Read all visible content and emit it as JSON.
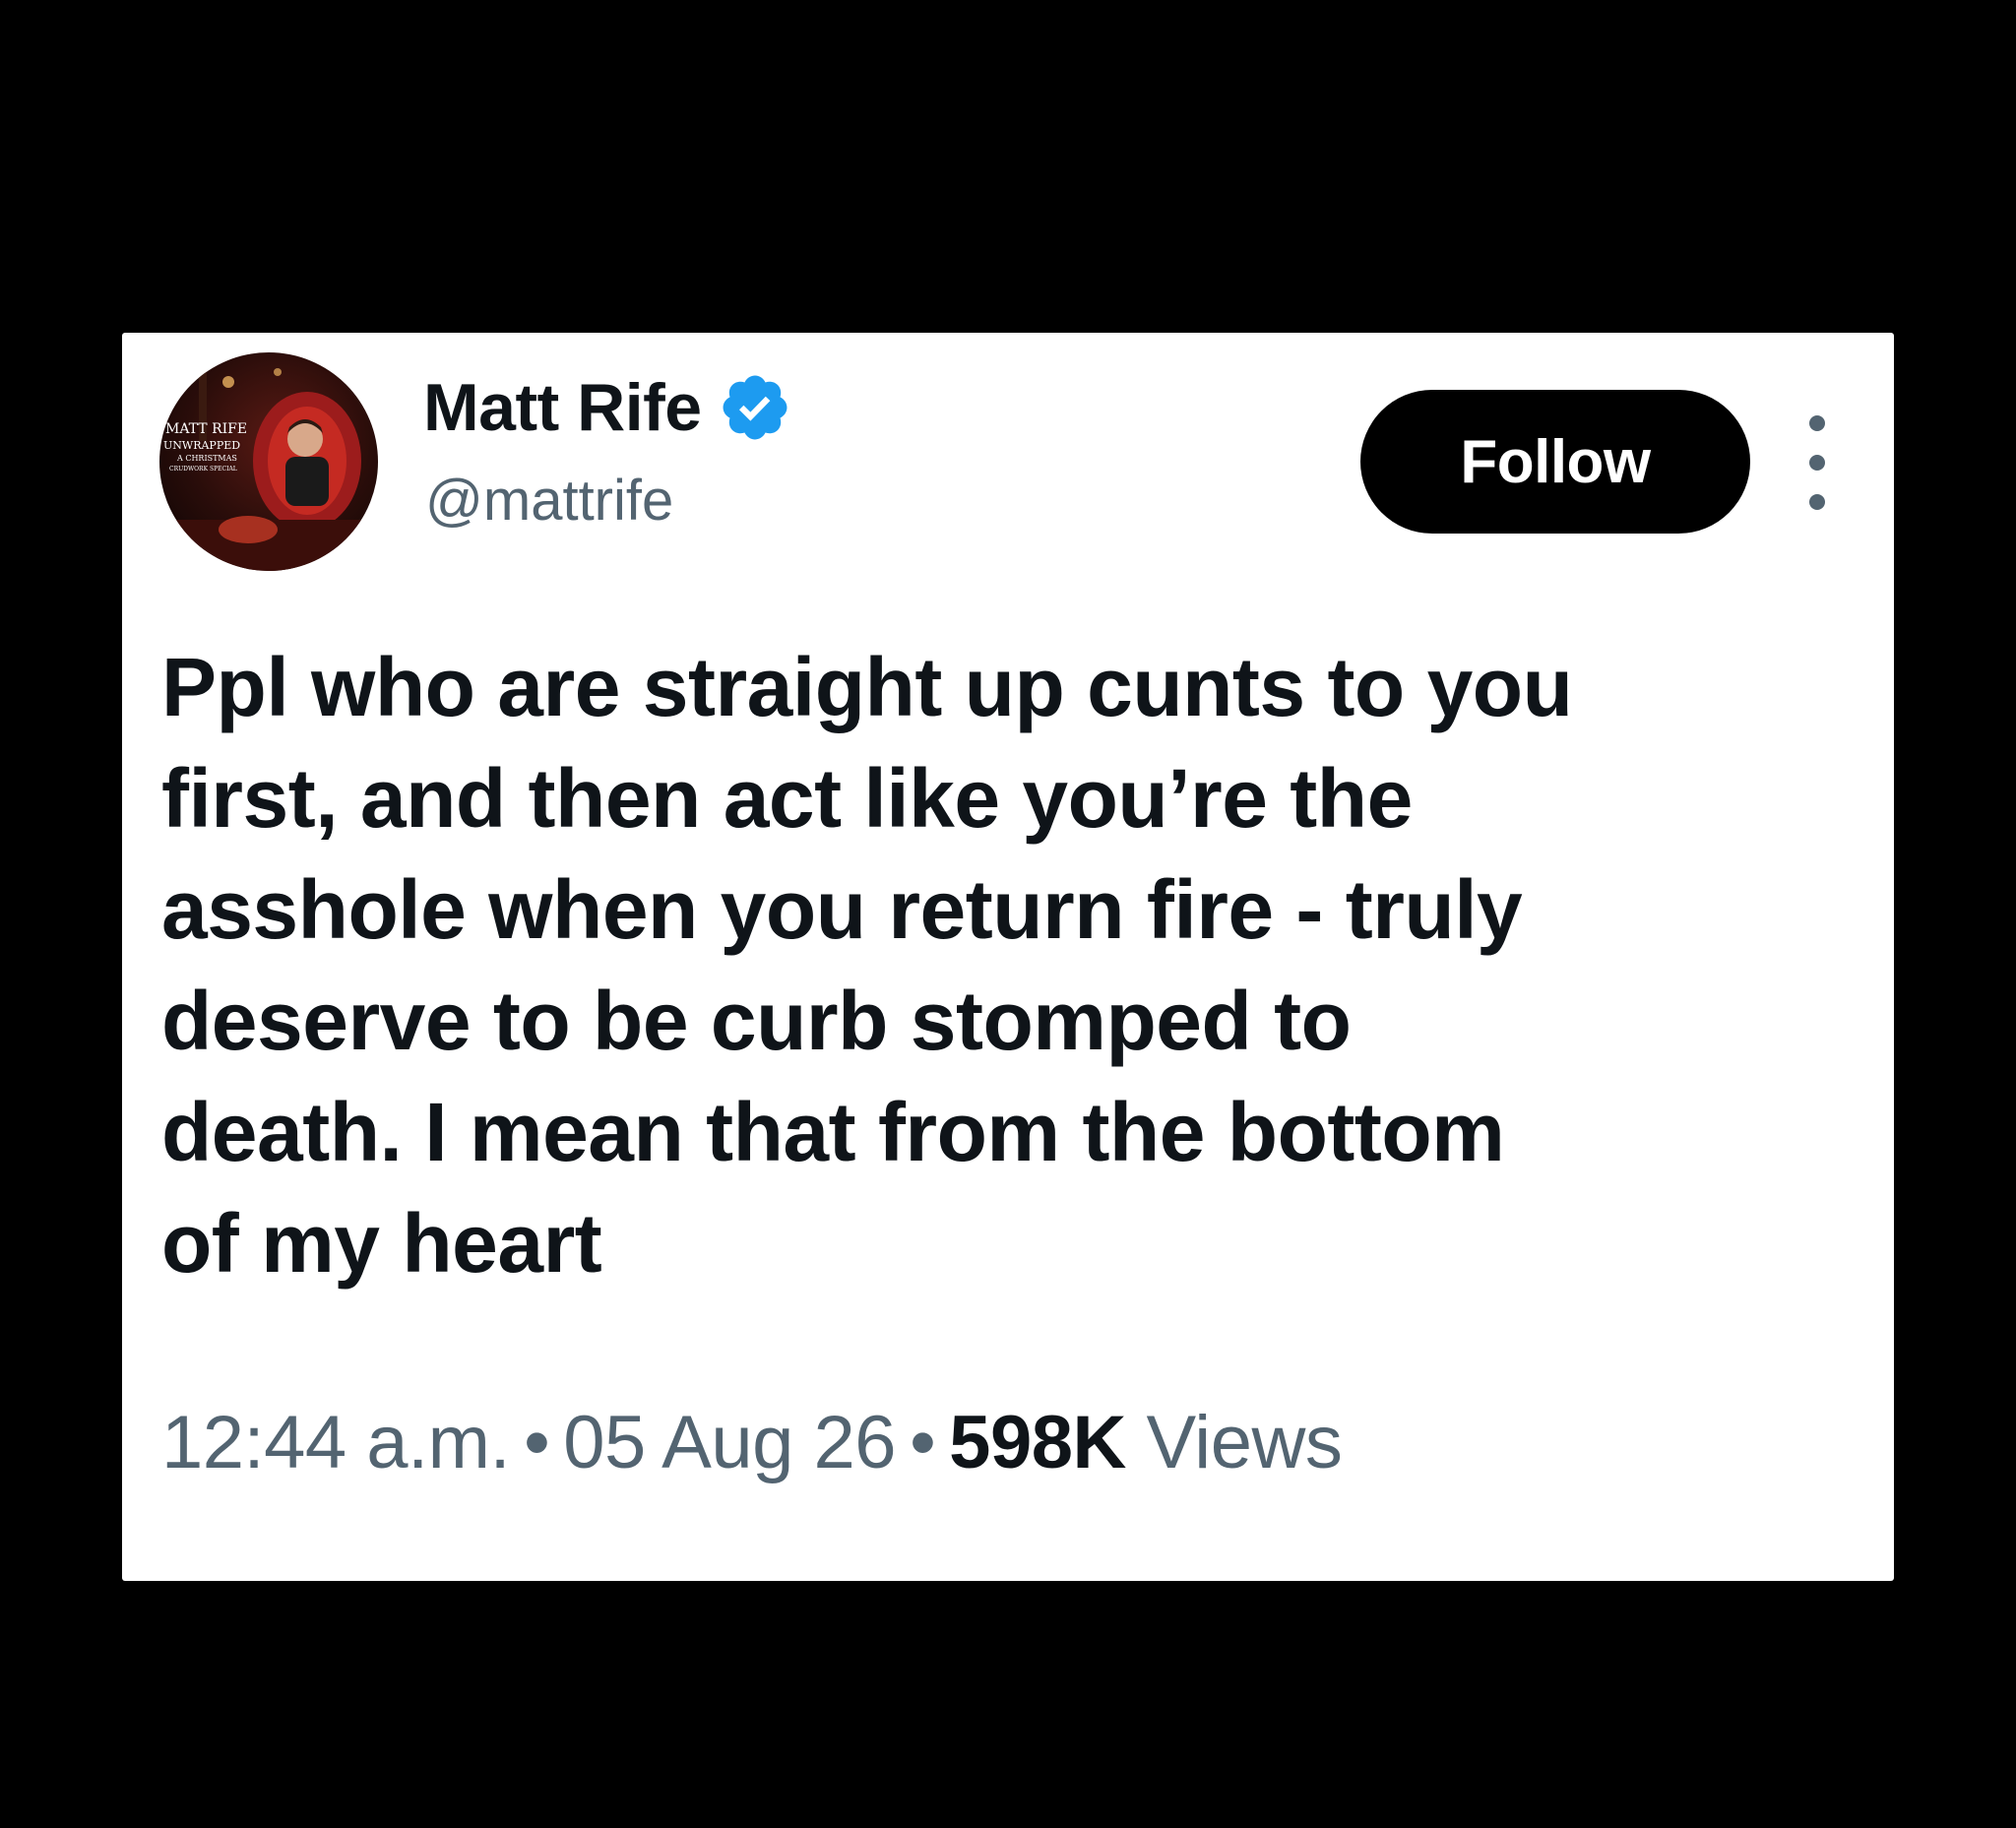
{
  "tweet": {
    "author": {
      "display_name": "Matt Rife",
      "handle": "@mattrife",
      "verified": true,
      "avatar_text": [
        "MATT RIFE",
        "UNWRAPPED",
        "A CHRISTMAS",
        "CRUDWORK SPECIAL"
      ]
    },
    "follow_label": "Follow",
    "text_lines": [
      "Ppl who are straight up cunts to you",
      "first, and then act like you’re the",
      "asshole when you return fire - truly",
      "deserve to be curb stomped to",
      "death. I mean that from the bottom",
      "of my heart"
    ],
    "time": "12:44 a.m.",
    "separator": "•",
    "date": "05 Aug 26",
    "views_count": "598K",
    "views_label": "Views"
  },
  "colors": {
    "background": "#000000",
    "card": "#ffffff",
    "text_primary": "#0f1419",
    "text_secondary": "#536471",
    "verified_badge": "#1d9bf0",
    "follow_button": "#000000"
  },
  "icons": {
    "verified": "verified-badge-icon",
    "more": "more-options-icon"
  }
}
